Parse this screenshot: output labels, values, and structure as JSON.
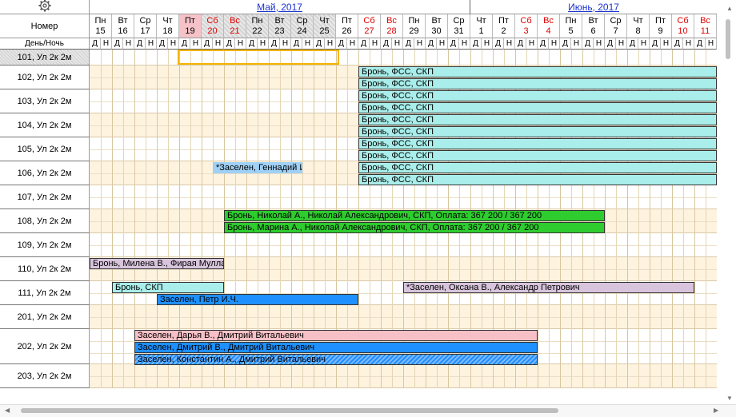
{
  "header": {
    "nomer_label": "Номер",
    "daynight_label": "День/Ночь",
    "day_letter": "Д",
    "night_letter": "Н",
    "months": [
      {
        "label": "Май, 2017"
      },
      {
        "label": "Июнь, 2017"
      }
    ]
  },
  "days": [
    {
      "dow": "Пн",
      "num": "15",
      "weekend": false,
      "highlight": ""
    },
    {
      "dow": "Вт",
      "num": "16",
      "weekend": false,
      "highlight": ""
    },
    {
      "dow": "Ср",
      "num": "17",
      "weekend": false,
      "highlight": ""
    },
    {
      "dow": "Чт",
      "num": "18",
      "weekend": false,
      "highlight": ""
    },
    {
      "dow": "Пт",
      "num": "19",
      "weekend": false,
      "highlight": "pink"
    },
    {
      "dow": "Сб",
      "num": "20",
      "weekend": true,
      "highlight": "grey"
    },
    {
      "dow": "Вс",
      "num": "21",
      "weekend": true,
      "highlight": "grey"
    },
    {
      "dow": "Пн",
      "num": "22",
      "weekend": false,
      "highlight": "grey"
    },
    {
      "dow": "Вт",
      "num": "23",
      "weekend": false,
      "highlight": "grey"
    },
    {
      "dow": "Ср",
      "num": "24",
      "weekend": false,
      "highlight": "grey"
    },
    {
      "dow": "Чт",
      "num": "25",
      "weekend": false,
      "highlight": "grey"
    },
    {
      "dow": "Пт",
      "num": "26",
      "weekend": false,
      "highlight": ""
    },
    {
      "dow": "Сб",
      "num": "27",
      "weekend": true,
      "highlight": ""
    },
    {
      "dow": "Вс",
      "num": "28",
      "weekend": true,
      "highlight": ""
    },
    {
      "dow": "Пн",
      "num": "29",
      "weekend": false,
      "highlight": ""
    },
    {
      "dow": "Вт",
      "num": "30",
      "weekend": false,
      "highlight": ""
    },
    {
      "dow": "Ср",
      "num": "31",
      "weekend": false,
      "highlight": ""
    },
    {
      "dow": "Чт",
      "num": "1",
      "weekend": false,
      "highlight": ""
    },
    {
      "dow": "Пт",
      "num": "2",
      "weekend": false,
      "highlight": ""
    },
    {
      "dow": "Сб",
      "num": "3",
      "weekend": true,
      "highlight": ""
    },
    {
      "dow": "Вс",
      "num": "4",
      "weekend": true,
      "highlight": ""
    },
    {
      "dow": "Пн",
      "num": "5",
      "weekend": false,
      "highlight": ""
    },
    {
      "dow": "Вт",
      "num": "6",
      "weekend": false,
      "highlight": ""
    },
    {
      "dow": "Ср",
      "num": "7",
      "weekend": false,
      "highlight": ""
    },
    {
      "dow": "Чт",
      "num": "8",
      "weekend": false,
      "highlight": ""
    },
    {
      "dow": "Пт",
      "num": "9",
      "weekend": false,
      "highlight": ""
    },
    {
      "dow": "Сб",
      "num": "10",
      "weekend": true,
      "highlight": ""
    },
    {
      "dow": "Вс",
      "num": "11",
      "weekend": true,
      "highlight": ""
    }
  ],
  "rooms": [
    {
      "label": "101, Ул 2к 2м",
      "lines": 1,
      "selected": true
    },
    {
      "label": "102, Ул 2к 2м",
      "lines": 2,
      "selected": false
    },
    {
      "label": "103, Ул 2к 2м",
      "lines": 2,
      "selected": false
    },
    {
      "label": "104, Ул 2к 2м",
      "lines": 2,
      "selected": false
    },
    {
      "label": "105, Ул 2к 2м",
      "lines": 2,
      "selected": false
    },
    {
      "label": "106, Ул 2к 2м",
      "lines": 2,
      "selected": false
    },
    {
      "label": "107, Ул 2к 2м",
      "lines": 2,
      "selected": false
    },
    {
      "label": "108, Ул 2к 2м",
      "lines": 2,
      "selected": false
    },
    {
      "label": "109, Ул 2к 2м",
      "lines": 2,
      "selected": false
    },
    {
      "label": "110, Ул 2к 2м",
      "lines": 2,
      "selected": false
    },
    {
      "label": "111, Ул 2к 2м",
      "lines": 2,
      "selected": false
    },
    {
      "label": "201, Ул 2к 2м",
      "lines": 2,
      "selected": false
    },
    {
      "label": "202, Ул 2к 2м",
      "lines": 3,
      "selected": false
    },
    {
      "label": "203, Ул 2к 2м",
      "lines": 2,
      "selected": false
    }
  ],
  "colors": {
    "cyan": "#a9eeea",
    "green": "#2ecc2e",
    "pink": "#f7c0c6",
    "blue": "#1e90ff",
    "lilac": "#d8c4dc",
    "lightblue": "#9fd0f5",
    "hatch": "#cfe6ff"
  },
  "bookings": [
    {
      "row": 1,
      "line": 0,
      "start": 24,
      "end": 56,
      "color": "cyan",
      "text": "Бронь, ФСС, СКП"
    },
    {
      "row": 1,
      "line": 1,
      "start": 24,
      "end": 56,
      "color": "cyan",
      "text": "Бронь, ФСС, СКП"
    },
    {
      "row": 2,
      "line": 0,
      "start": 24,
      "end": 56,
      "color": "cyan",
      "text": "Бронь, ФСС, СКП"
    },
    {
      "row": 2,
      "line": 1,
      "start": 24,
      "end": 56,
      "color": "cyan",
      "text": "Бронь, ФСС, СКП"
    },
    {
      "row": 3,
      "line": 0,
      "start": 24,
      "end": 56,
      "color": "cyan",
      "text": "Бронь, ФСС, СКП"
    },
    {
      "row": 3,
      "line": 1,
      "start": 24,
      "end": 56,
      "color": "cyan",
      "text": "Бронь, ФСС, СКП"
    },
    {
      "row": 4,
      "line": 0,
      "start": 24,
      "end": 56,
      "color": "cyan",
      "text": "Бронь, ФСС, СКП"
    },
    {
      "row": 4,
      "line": 1,
      "start": 24,
      "end": 56,
      "color": "cyan",
      "text": "Бронь, ФСС, СКП"
    },
    {
      "row": 5,
      "line": 0,
      "start": 11,
      "end": 19,
      "color": "lightblue",
      "text": "*Заселен, Геннадий И",
      "borderless": true
    },
    {
      "row": 5,
      "line": 0,
      "start": 24,
      "end": 56,
      "color": "cyan",
      "text": "Бронь, ФСС, СКП"
    },
    {
      "row": 5,
      "line": 1,
      "start": 24,
      "end": 56,
      "color": "cyan",
      "text": "Бронь, ФСС, СКП"
    },
    {
      "row": 7,
      "line": 0,
      "start": 12,
      "end": 46,
      "color": "green",
      "text": "Бронь, Николай А., Николай Александрович, СКП, Оплата: 367 200 / 367 200"
    },
    {
      "row": 7,
      "line": 1,
      "start": 12,
      "end": 46,
      "color": "green",
      "text": "Бронь, Марина А., Николай Александрович, СКП, Оплата: 367 200 / 367 200"
    },
    {
      "row": 9,
      "line": 0,
      "start": 0,
      "end": 12,
      "color": "lilac",
      "text": "Бронь, Милена В., Фирая Муллан"
    },
    {
      "row": 10,
      "line": 0,
      "start": 2,
      "end": 12,
      "color": "cyan",
      "text": "Бронь, СКП"
    },
    {
      "row": 10,
      "line": 0,
      "start": 28,
      "end": 54,
      "color": "lilac",
      "text": "*Заселен, Оксана В., Александр Петрович"
    },
    {
      "row": 10,
      "line": 1,
      "start": 6,
      "end": 24,
      "color": "blue",
      "text": "Заселен, Петр И.Ч."
    },
    {
      "row": 12,
      "line": 0,
      "start": 4,
      "end": 40,
      "color": "pink",
      "text": "Заселен, Дарья В., Дмитрий Витальевич"
    },
    {
      "row": 12,
      "line": 1,
      "start": 4,
      "end": 40,
      "color": "blue",
      "text": "Заселен, Дмитрий В., Дмитрий Витальевич"
    },
    {
      "row": 12,
      "line": 2,
      "start": 4,
      "end": 40,
      "color": "blue",
      "text": "Заселен, Константин А., Дмитрий Витальевич",
      "hatched": true
    }
  ]
}
